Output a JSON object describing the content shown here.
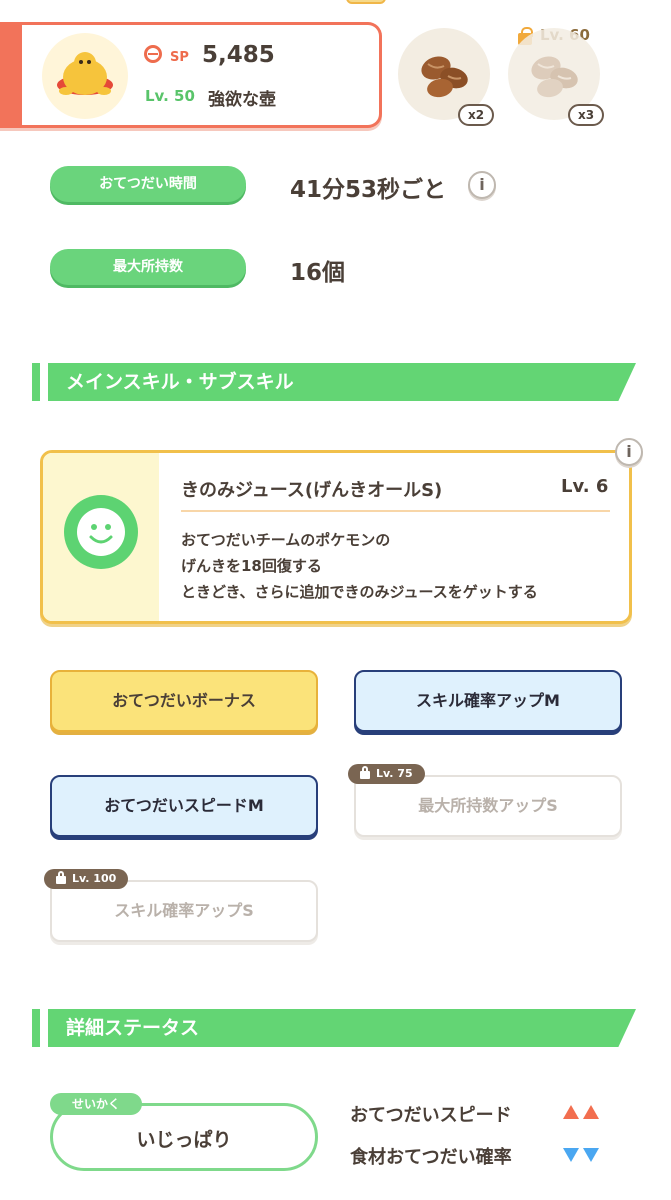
{
  "pokemon_card": {
    "sp_label": "SP",
    "sp_value": "5,485",
    "level_label": "Lv. 50",
    "main_subskill": "強欲な壺"
  },
  "ingredients": [
    {
      "icon": "walnut-icon",
      "count_label": "x2",
      "locked": false
    },
    {
      "icon": "walnut-icon",
      "count_label": "x3",
      "locked": true,
      "unlock_label": "Lv. 60"
    }
  ],
  "stats": {
    "help_time_label": "おてつだい時間",
    "help_time_value": "41分53秒ごと",
    "max_carry_label": "最大所持数",
    "max_carry_value": "16個",
    "info_glyph": "i"
  },
  "skills_section": {
    "title": "メインスキル・サブスキル",
    "main_skill": {
      "name": "きのみジュース(げんきオールS)",
      "level": "Lv. 6",
      "desc_lines": [
        "おてつだいチームのポケモンの",
        "げんきを18回復する",
        "ときどき、さらに追加できのみジュースをゲットする"
      ]
    },
    "sub_skills": [
      {
        "label": "おてつだいボーナス",
        "style": "gold",
        "locked": false
      },
      {
        "label": "スキル確率アップM",
        "style": "blue",
        "locked": false
      },
      {
        "label": "おてつだいスピードM",
        "style": "blue",
        "locked": false
      },
      {
        "label": "最大所持数アップS",
        "style": "locked",
        "locked": true,
        "unlock_label": "Lv. 75"
      },
      {
        "label": "スキル確率アップS",
        "style": "locked",
        "locked": true,
        "unlock_label": "Lv. 100"
      }
    ]
  },
  "details_section": {
    "title": "詳細ステータス",
    "nature_tag": "せいかく",
    "nature_value": "いじっぱり",
    "effects": [
      {
        "label": "おてつだいスピード",
        "direction": "up",
        "color": "#f26e4f"
      },
      {
        "label": "食材おてつだい確率",
        "direction": "down",
        "color": "#4aa7f1"
      }
    ]
  },
  "colors": {
    "accent_green": "#63d574",
    "accent_orange": "#f2735a",
    "gold": "#f1c04b",
    "navy": "#283f7a"
  }
}
